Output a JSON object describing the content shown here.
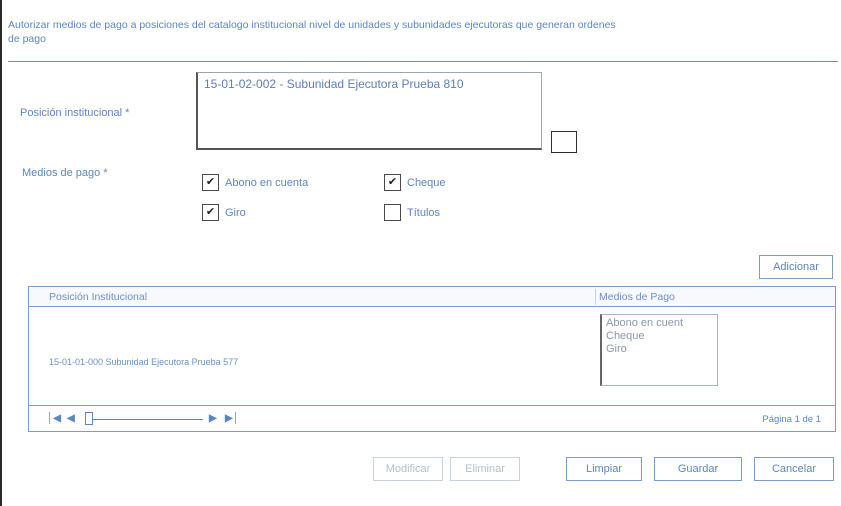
{
  "header": {
    "title_line1": "Autorizar medios de pago a posiciones del catalogo institucional nivel de unidades y subunidades ejecutoras que generan ordenes",
    "title_line2": "de pago"
  },
  "form": {
    "posicion_label": "Posición institucional *",
    "posicion_value": "15-01-02-002 - Subunidad Ejecutora Prueba 810",
    "medios_label": "Medios de pago *",
    "medios": [
      {
        "label": "Abono en cuenta",
        "checked": true
      },
      {
        "label": "Cheque",
        "checked": true
      },
      {
        "label": "Giro",
        "checked": true
      },
      {
        "label": "Títulos",
        "checked": false
      }
    ]
  },
  "buttons": {
    "adicionar": "Adicionar",
    "modificar": "Modificar",
    "eliminar": "Eliminar",
    "limpiar": "Limpiar",
    "guardar": "Guardar",
    "cancelar": "Cancelar"
  },
  "grid": {
    "columns": [
      "Posición Institucional",
      "Medios de Pago"
    ],
    "rows": [
      {
        "posicion": "15-01-01-000 Subunidad Ejecutora Prueba 577",
        "medios": [
          "Abono en cuent",
          "Cheque",
          "Giro"
        ]
      }
    ],
    "pager": {
      "first_icon": "first-page-icon",
      "prev_icon": "prev-page-icon",
      "next_icon": "next-page-icon",
      "last_icon": "last-page-icon",
      "page_text": "Página 1 de 1"
    }
  }
}
